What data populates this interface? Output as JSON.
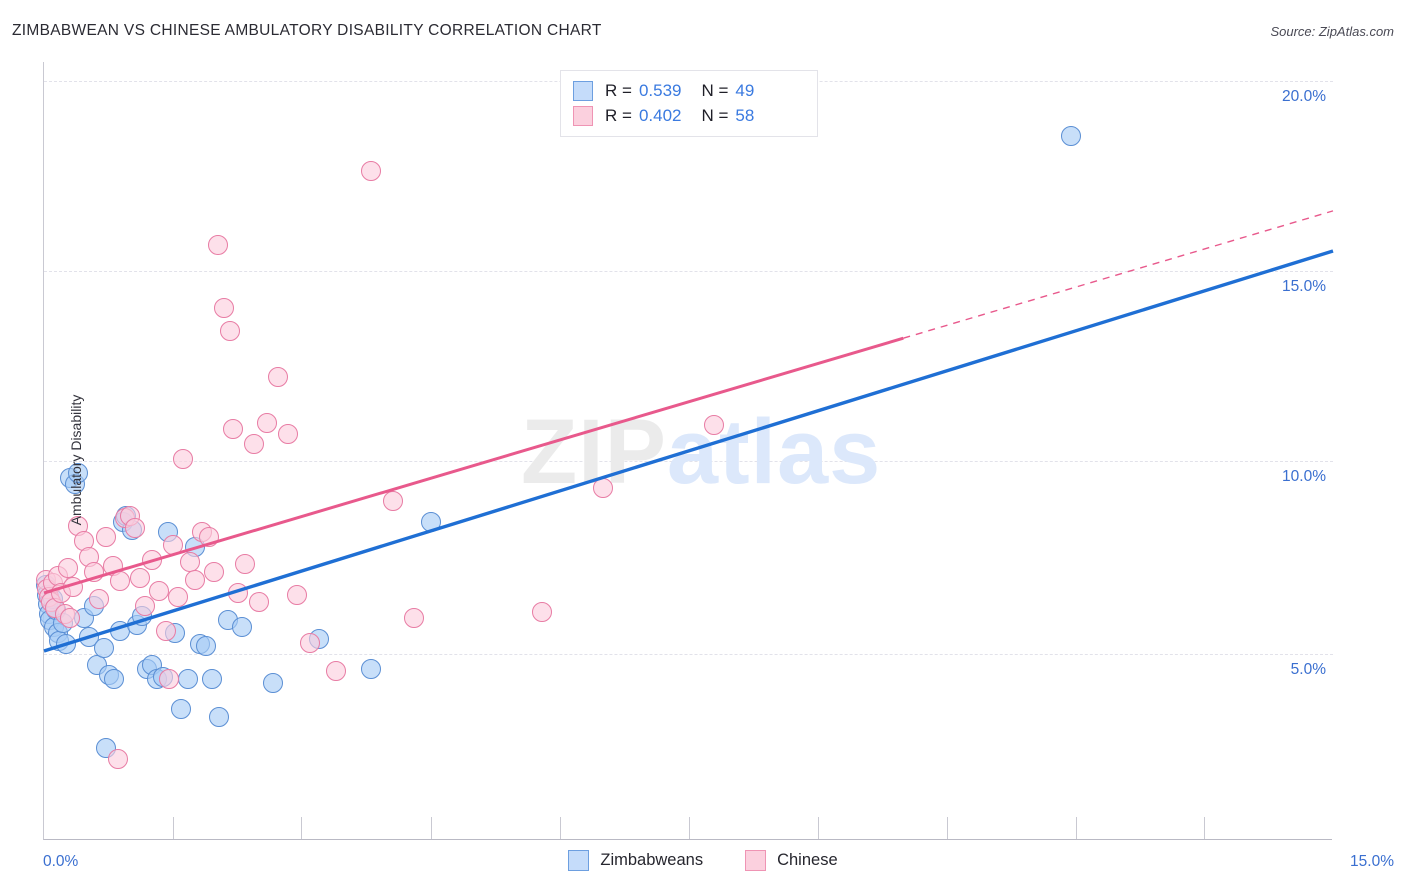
{
  "header": {
    "title": "ZIMBABWEAN VS CHINESE AMBULATORY DISABILITY CORRELATION CHART",
    "source": "Source: ZipAtlas.com"
  },
  "watermark": {
    "part1": "ZIP",
    "part2": "atlas"
  },
  "correlation_legend": {
    "rows": [
      {
        "series": "Zimbabweans",
        "color": "#c5dcfa",
        "r_label": "R =",
        "r_value": "0.539",
        "n_label": "N =",
        "n_value": "49"
      },
      {
        "series": "Chinese",
        "color": "#fbd0de",
        "r_label": "R =",
        "r_value": "0.402",
        "n_label": "N =",
        "n_value": "58"
      }
    ]
  },
  "series_legend": [
    {
      "label": "Zimbabweans",
      "color": "#c5dcfa"
    },
    {
      "label": "Chinese",
      "color": "#fbd0de"
    }
  ],
  "chart_data": {
    "type": "scatter",
    "title": "ZIMBABWEAN VS CHINESE AMBULATORY DISABILITY CORRELATION CHART",
    "xlabel": "",
    "ylabel": "Ambulatory Disability",
    "xlim": [
      0.0,
      15.0
    ],
    "ylim": [
      2.0,
      20.5
    ],
    "grid": true,
    "x_tick_labels": [
      "0.0%",
      "15.0%"
    ],
    "y_tick_labels": [
      "20.0%",
      "15.0%",
      "10.0%",
      "5.0%"
    ],
    "y_ticks": [
      20.0,
      15.0,
      10.0,
      5.0
    ],
    "legend_position": "bottom-center",
    "accent_colors": {
      "blue_fill": "#a7ccf6",
      "blue_stroke": "#5b8fd4",
      "pink_fill": "#fccddd",
      "pink_stroke": "#e87ca4",
      "blue_line": "#1f6fd4",
      "pink_line": "#e8598c",
      "tick_text": "#3a6fd0"
    },
    "series": [
      {
        "name": "Zimbabweans",
        "color": "#a7ccf6",
        "r": 0.539,
        "n": 49,
        "trendline": {
          "x0": 0.0,
          "y0": 5.08,
          "x1": 15.0,
          "y1": 15.55,
          "style": "solid"
        },
        "points": [
          [
            0.02,
            6.8
          ],
          [
            0.03,
            6.55
          ],
          [
            0.05,
            6.3
          ],
          [
            0.06,
            6.05
          ],
          [
            0.07,
            5.9
          ],
          [
            0.1,
            6.45
          ],
          [
            0.12,
            5.7
          ],
          [
            0.14,
            6.15
          ],
          [
            0.16,
            5.55
          ],
          [
            0.18,
            5.35
          ],
          [
            0.22,
            5.8
          ],
          [
            0.26,
            5.25
          ],
          [
            0.3,
            9.6
          ],
          [
            0.36,
            9.45
          ],
          [
            0.4,
            9.75
          ],
          [
            0.46,
            5.95
          ],
          [
            0.52,
            5.45
          ],
          [
            0.58,
            6.25
          ],
          [
            0.62,
            4.7
          ],
          [
            0.7,
            5.15
          ],
          [
            0.76,
            4.45
          ],
          [
            0.82,
            4.35
          ],
          [
            0.88,
            5.6
          ],
          [
            0.92,
            8.45
          ],
          [
            0.96,
            8.6
          ],
          [
            1.02,
            8.25
          ],
          [
            1.08,
            5.75
          ],
          [
            1.14,
            6.0
          ],
          [
            1.2,
            4.6
          ],
          [
            1.26,
            4.7
          ],
          [
            1.32,
            4.35
          ],
          [
            1.38,
            4.4
          ],
          [
            1.44,
            8.2
          ],
          [
            1.52,
            5.55
          ],
          [
            1.6,
            3.55
          ],
          [
            1.68,
            4.35
          ],
          [
            1.76,
            7.8
          ],
          [
            1.82,
            5.25
          ],
          [
            1.88,
            5.2
          ],
          [
            1.96,
            4.35
          ],
          [
            2.04,
            3.35
          ],
          [
            2.14,
            5.9
          ],
          [
            2.3,
            5.7
          ],
          [
            2.66,
            4.25
          ],
          [
            3.2,
            5.4
          ],
          [
            3.8,
            4.6
          ],
          [
            4.5,
            8.45
          ],
          [
            0.72,
            2.55
          ],
          [
            11.95,
            18.55
          ]
        ]
      },
      {
        "name": "Chinese",
        "color": "#fccddd",
        "r": 0.402,
        "n": 58,
        "trendline": {
          "x0": 0.0,
          "y0": 6.6,
          "x1": 15.0,
          "y1": 16.6,
          "style": "solid-then-dashed",
          "dash_start_x": 10.0
        },
        "points": [
          [
            0.02,
            6.95
          ],
          [
            0.04,
            6.7
          ],
          [
            0.06,
            6.5
          ],
          [
            0.08,
            6.35
          ],
          [
            0.1,
            6.85
          ],
          [
            0.13,
            6.2
          ],
          [
            0.16,
            7.05
          ],
          [
            0.2,
            6.6
          ],
          [
            0.24,
            6.05
          ],
          [
            0.28,
            7.25
          ],
          [
            0.34,
            6.75
          ],
          [
            0.4,
            8.35
          ],
          [
            0.46,
            7.95
          ],
          [
            0.52,
            7.55
          ],
          [
            0.58,
            7.15
          ],
          [
            0.64,
            6.45
          ],
          [
            0.72,
            8.05
          ],
          [
            0.8,
            7.3
          ],
          [
            0.88,
            6.9
          ],
          [
            0.94,
            8.55
          ],
          [
            1.0,
            8.6
          ],
          [
            1.06,
            8.3
          ],
          [
            1.12,
            7.0
          ],
          [
            1.18,
            6.25
          ],
          [
            1.26,
            7.45
          ],
          [
            1.34,
            6.65
          ],
          [
            1.42,
            5.6
          ],
          [
            1.5,
            7.85
          ],
          [
            1.56,
            6.5
          ],
          [
            1.62,
            10.1
          ],
          [
            1.7,
            7.4
          ],
          [
            1.76,
            6.95
          ],
          [
            1.84,
            8.2
          ],
          [
            1.92,
            8.05
          ],
          [
            1.98,
            7.15
          ],
          [
            2.02,
            15.7
          ],
          [
            2.1,
            14.05
          ],
          [
            2.16,
            13.45
          ],
          [
            2.2,
            10.9
          ],
          [
            2.26,
            6.6
          ],
          [
            2.34,
            7.35
          ],
          [
            2.44,
            10.5
          ],
          [
            2.6,
            11.05
          ],
          [
            2.72,
            12.25
          ],
          [
            2.84,
            10.75
          ],
          [
            3.1,
            5.3
          ],
          [
            3.4,
            4.55
          ],
          [
            3.8,
            17.65
          ],
          [
            4.06,
            9.0
          ],
          [
            4.3,
            5.95
          ],
          [
            5.8,
            6.1
          ],
          [
            6.5,
            9.35
          ],
          [
            7.8,
            11.0
          ],
          [
            0.3,
            5.95
          ],
          [
            0.86,
            2.25
          ],
          [
            1.46,
            4.35
          ],
          [
            2.5,
            6.35
          ],
          [
            2.94,
            6.55
          ]
        ]
      }
    ]
  }
}
